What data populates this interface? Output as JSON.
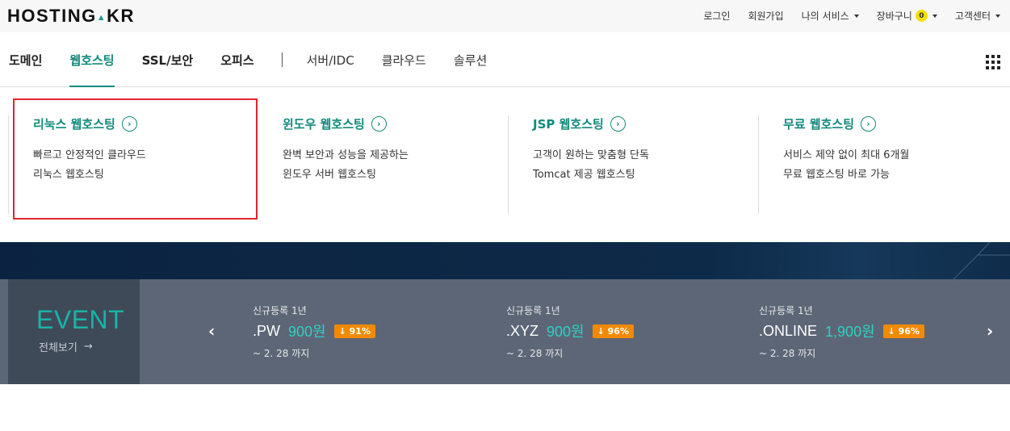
{
  "brand": {
    "logo_text_a": "HOSTING",
    "logo_dot": "▲",
    "logo_text_b": "KR"
  },
  "utility": {
    "login": "로그인",
    "signup": "회원가입",
    "my_service": "나의 서비스",
    "cart": "장바구니",
    "cart_count": "0",
    "support": "고객센터"
  },
  "nav": {
    "items": [
      "도메인",
      "웹호스팅",
      "SSL/보안",
      "오피스",
      "서버/IDC",
      "클라우드",
      "솔루션"
    ],
    "active": "웹호스팅"
  },
  "submenu": [
    {
      "title": "리눅스 웹호스팅",
      "line1": "빠르고 안정적인 클라우드",
      "line2": "리눅스 웹호스팅"
    },
    {
      "title": "윈도우 웹호스팅",
      "line1": "완벽 보안과 성능을 제공하는",
      "line2": "윈도우 서버 웹호스팅"
    },
    {
      "title": "JSP 웹호스팅",
      "line1": "고객이 원하는 맞춤형 단독",
      "line2": "Tomcat 제공 웹호스팅"
    },
    {
      "title": "무료 웹호스팅",
      "line1": "서비스 제약 없이 최대 6개월",
      "line2": "무료 웹호스팅 바로 가능"
    }
  ],
  "event": {
    "title": "EVENT",
    "view_all": "전체보기",
    "view_all_arrow": "→",
    "prev": "‹",
    "next": "›",
    "deals": [
      {
        "label": "신규등록 1년",
        "tld": ".PW",
        "price": "900원",
        "discount": "↓ 91%",
        "until": "~ 2. 28 까지"
      },
      {
        "label": "신규등록 1년",
        "tld": ".XYZ",
        "price": "900원",
        "discount": "↓ 96%",
        "until": "~ 2. 28 까지"
      },
      {
        "label": "신규등록 1년",
        "tld": ".ONLINE",
        "price": "1,900원",
        "discount": "↓ 96%",
        "until": "~ 2. 28 까지"
      }
    ]
  },
  "colors": {
    "accent": "#128a7c",
    "highlight": "#e0262e",
    "discount": "#f08a00",
    "event_bg": "#5c6676"
  }
}
